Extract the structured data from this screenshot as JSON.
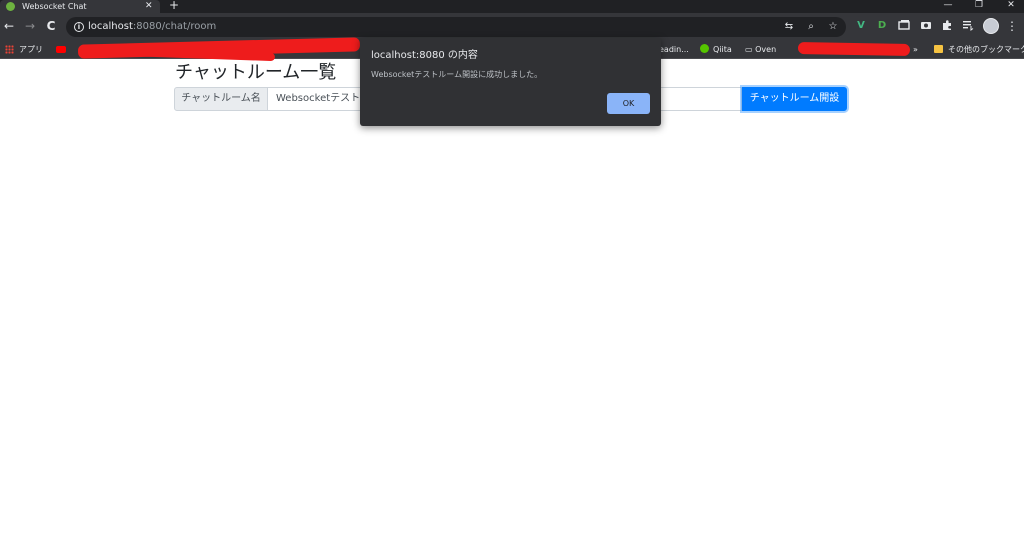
{
  "browser": {
    "tab_title": "Websocket Chat",
    "tab_close": "✕",
    "new_tab": "+",
    "window_controls": {
      "minimize": "—",
      "restore": "❐",
      "close": "✕"
    },
    "nav": {
      "back": "←",
      "forward": "→",
      "reload": "C"
    },
    "url_host": "localhost",
    "url_path": ":8080/chat/room",
    "info": "i",
    "omnibox_icons": {
      "translate": "⇆",
      "zoom": "⌕",
      "bookmark_star": "☆"
    },
    "extensions": {
      "vue": "V",
      "dl": "D",
      "menu": "⋮"
    },
    "bookmarks": {
      "apps": "アプリ",
      "reading": "eadin...",
      "qiita": "Qiita",
      "oven": "Oven",
      "overflow": "»",
      "other": "その他のブックマーク"
    }
  },
  "page": {
    "title": "チャットルーム一覧",
    "room_label": "チャットルーム名",
    "room_input_value": "Websocketテストル",
    "create_button": "チャットルーム開設"
  },
  "alert": {
    "title": "localhost:8080 の内容",
    "message": "Websocketテストルーム開設に成功しました。",
    "ok": "OK"
  },
  "colors": {
    "accent": "#007bff",
    "dialog_bg": "#303134",
    "dialog_button": "#8ab4f8",
    "redaction": "#ee1c1c"
  }
}
